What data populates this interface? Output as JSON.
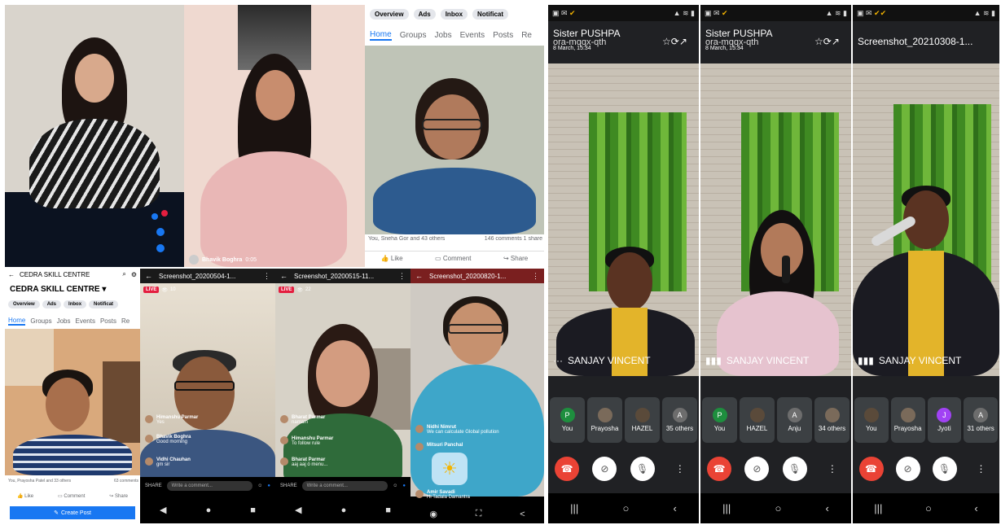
{
  "fb_top": {
    "pills": [
      "Overview",
      "Ads",
      "Inbox",
      "Notificat"
    ],
    "tabs": [
      "Home",
      "Groups",
      "Jobs",
      "Events",
      "Posts",
      "Re"
    ],
    "reactions": "You, Sneha Gor and 43 others",
    "counts": "146 comments 1 share",
    "like": "Like",
    "comment": "Comment",
    "share": "Share",
    "host_name": "Bhavik Boghra",
    "host_time": "0:05"
  },
  "fb_page": {
    "header": "CEDRA SKILL CENTRE",
    "title": "CEDRA SKILL CENTRE",
    "pills": [
      "Overview",
      "Ads",
      "Inbox",
      "Notificat"
    ],
    "tabs": [
      "Home",
      "Groups",
      "Jobs",
      "Events",
      "Posts",
      "Re"
    ],
    "reactions": "You, Prayosha Patel and 33 others",
    "counts": "63 comments",
    "like": "Like",
    "comment": "Comment",
    "share": "Share",
    "create_post": "Create Post"
  },
  "live1": {
    "title": "Screenshot_20200504-1...",
    "live": "LIVE",
    "viewers": "10",
    "comments": [
      {
        "name": "Himanshu Parmar",
        "text": "Yes"
      },
      {
        "name": "Bhavik Boghra",
        "text": "Good morning"
      },
      {
        "name": "Vidhi Chauhan",
        "text": "gm sir"
      }
    ],
    "share": "SHARE",
    "placeholder": "Write a comment..."
  },
  "live2": {
    "title": "Screenshot_20200515-11...",
    "live": "LIVE",
    "viewers": "22",
    "comments": [
      {
        "name": "Bharat Parmar",
        "text": "namam"
      },
      {
        "name": "Himanshu Parmar",
        "text": "To follow rule"
      },
      {
        "name": "Bharat Parmar",
        "text": "aaj aaj ó menu..."
      }
    ],
    "share": "SHARE",
    "placeholder": "Write a comment..."
  },
  "live3": {
    "title": "Screenshot_20200820-1...",
    "comments": [
      {
        "name": "Nidhi Nimrut",
        "text": "We can calculate Global pollution"
      },
      {
        "name": "Mitsuri Panchal",
        "text": ""
      },
      {
        "name": "Amir Savadi",
        "text": "Hi Tadala Damantra"
      }
    ]
  },
  "meet1": {
    "title": "Sister PUSHPA",
    "code": "ora-mqqx-qth",
    "date": "8 March, 15:34",
    "speaker": "SANJAY VINCENT",
    "participants": [
      {
        "label": "You",
        "initial": "P",
        "color": "#1e8e3e"
      },
      {
        "label": "Prayosha",
        "initial": "",
        "color": "#7a6a5a"
      },
      {
        "label": "HAZEL",
        "initial": "",
        "color": "#5a4a3a"
      },
      {
        "label": "35 others",
        "initial": "A",
        "color": "#6d6d6d"
      }
    ]
  },
  "meet2": {
    "title": "Sister PUSHPA",
    "code": "ora-mqqx-qth",
    "date": "8 March, 15:34",
    "speaker": "SANJAY VINCENT",
    "participants": [
      {
        "label": "You",
        "initial": "P",
        "color": "#1e8e3e"
      },
      {
        "label": "HAZEL",
        "initial": "",
        "color": "#5a4a3a"
      },
      {
        "label": "Anju",
        "initial": "A",
        "color": "#6d6d6d"
      },
      {
        "label": "34 others",
        "initial": "",
        "color": "#7a6a5a"
      }
    ]
  },
  "meet3": {
    "title": "Screenshot_20210308-1...",
    "speaker": "SANJAY VINCENT",
    "participants": [
      {
        "label": "You",
        "initial": "",
        "color": "#5a4a3a"
      },
      {
        "label": "Prayosha",
        "initial": "",
        "color": "#7a6a5a"
      },
      {
        "label": "Jyoti",
        "initial": "J",
        "color": "#a142f4"
      },
      {
        "label": "31 others",
        "initial": "A",
        "color": "#6d6d6d"
      }
    ]
  }
}
